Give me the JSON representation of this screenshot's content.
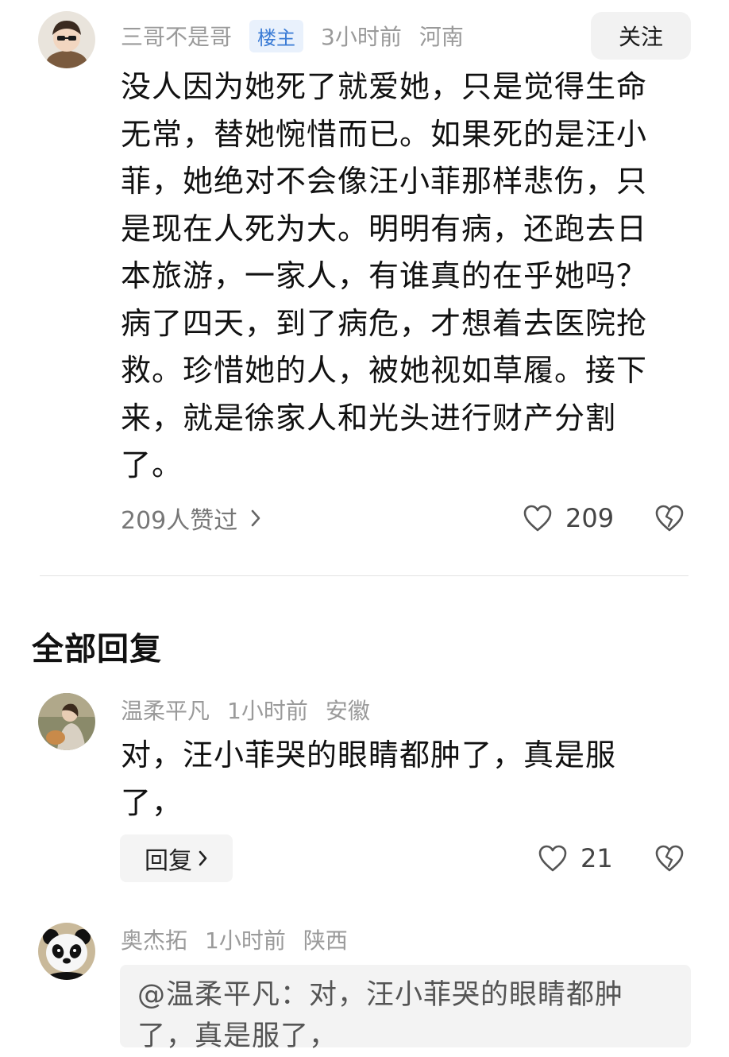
{
  "top_comment": {
    "author": "三哥不是哥",
    "badge": "楼主",
    "time": "3小时前",
    "location": "河南",
    "follow_label": "关注",
    "lines": [
      "没人因为她死了就爱她，只是觉得生命",
      "无常，替她惋惜而已。如果死的是汪小",
      "菲，她绝对不会像汪小菲那样悲伤，只",
      "是现在人死为大。明明有病，还跑去日",
      "本旅游，一家人，有谁真的在乎她吗？",
      "病了四天，到了病危，才想着去医院抢",
      "救。珍惜她的人，被她视如草履。接下",
      "来，就是徐家人和光头进行财产分割",
      "了。"
    ],
    "liked_by": "209人赞过",
    "like_count": "209"
  },
  "section_title": "全部回复",
  "replies": [
    {
      "author": "温柔平凡",
      "time": "1小时前",
      "location": "安徽",
      "lines": [
        "对，汪小菲哭的眼睛都肿了，真是服",
        "了，"
      ],
      "reply_label": "回复",
      "like_count": "21"
    },
    {
      "author": "奥杰拓",
      "time": "1小时前",
      "location": "陕西",
      "quote_lines": [
        "@温柔平凡：对，汪小菲哭的眼睛都肿",
        "了，真是服了，"
      ]
    }
  ],
  "icons": {
    "like": "heart-outline-icon",
    "dislike": "broken-heart-icon",
    "chevron": "chevron-right-icon"
  },
  "colors": {
    "badge_text": "#3a7bd5",
    "badge_bg": "#e9f1fc",
    "meta_gray": "#9a9a9a"
  }
}
